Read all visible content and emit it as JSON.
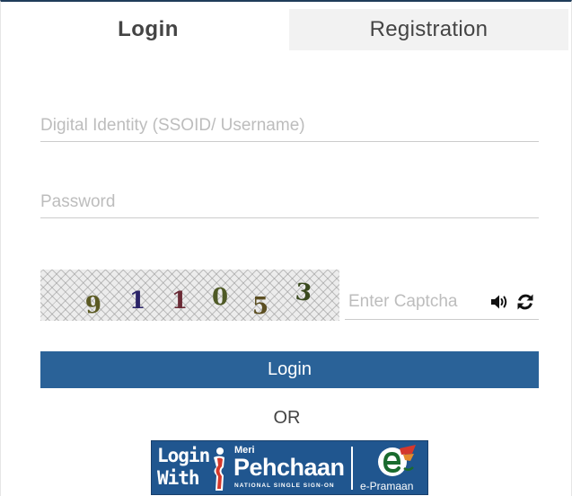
{
  "tabs": {
    "login": "Login",
    "registration": "Registration"
  },
  "form": {
    "username_placeholder": "Digital Identity (SSOID/ Username)",
    "password_placeholder": "Password",
    "captcha_placeholder": "Enter Captcha",
    "captcha_digits": [
      "9",
      "1",
      "1",
      "0",
      "5",
      "3"
    ],
    "login_button": "Login",
    "or_text": "OR"
  },
  "meri_pehchaan": {
    "login_line1": "Login",
    "login_line2": "With",
    "meri": "Meri",
    "pehchaan": "Pehchaan",
    "tagline": "NATIONAL SINGLE SIGN-ON",
    "e_pramaan": "e-Pramaan"
  },
  "colors": {
    "primary_button": "#2a6298",
    "meri_pehchaan_bg": "#20568f",
    "tab_inactive": "#f2f2f2"
  }
}
